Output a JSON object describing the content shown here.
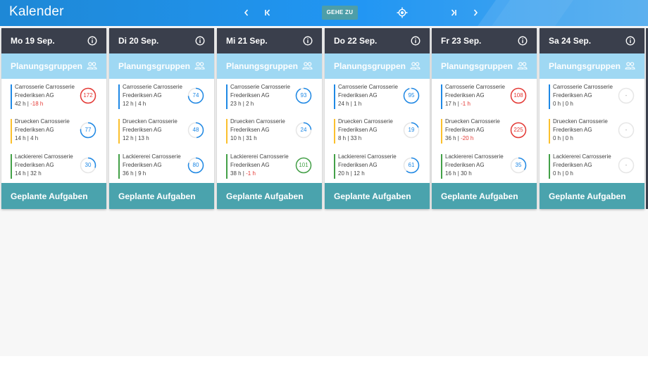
{
  "header": {
    "title": "Kalender",
    "prev_icon": "chevron-left-icon",
    "first_icon": "skip-first-icon",
    "goto_label": "GEHE ZU",
    "locate_icon": "crosshair-icon",
    "last_icon": "skip-last-icon",
    "next_icon": "chevron-right-icon"
  },
  "labels": {
    "planning_groups": "Planungsgruppen",
    "planned_tasks": "Geplante Aufgaben"
  },
  "colors": {
    "topbar": "#2196f3",
    "day_header": "#3a3f4c",
    "planning_bar": "#9fd8f3",
    "tasks_bar": "#4aa3ad",
    "group_blue": "#1e88e5",
    "group_yellow": "#fbc02d",
    "group_green": "#43a047",
    "ring_blue": "#1e88e5",
    "ring_red": "#e53935",
    "ring_green": "#43a047",
    "ring_empty": "#bdbdbd"
  },
  "days": [
    {
      "name": "Mo 19 Sep.",
      "entries": [
        {
          "name_line1": "Carrosserie Carrosserie",
          "name_line2": "Frederiksen AG",
          "h1": "42 h",
          "sep": " | ",
          "h2": "-18 h",
          "h2_negative": true,
          "load": "172",
          "status": "red",
          "fill": 1.0
        },
        {
          "name_line1": "Druecken Carrosserie",
          "name_line2": "Frederiksen AG",
          "h1": "14 h",
          "sep": " | ",
          "h2": "4 h",
          "h2_negative": false,
          "load": "77",
          "status": "blue",
          "fill": 0.77
        },
        {
          "name_line1": "Lackiererei Carrosserie",
          "name_line2": "Frederiksen AG",
          "h1": "14 h",
          "sep": " | ",
          "h2": "32 h",
          "h2_negative": false,
          "load": "30",
          "status": "blue",
          "fill": 0.3
        }
      ]
    },
    {
      "name": "Di 20 Sep.",
      "entries": [
        {
          "name_line1": "Carrosserie Carrosserie",
          "name_line2": "Frederiksen AG",
          "h1": "12 h",
          "sep": " | ",
          "h2": "4 h",
          "h2_negative": false,
          "load": "74",
          "status": "blue",
          "fill": 0.74
        },
        {
          "name_line1": "Druecken Carrosserie",
          "name_line2": "Frederiksen AG",
          "h1": "12 h",
          "sep": " | ",
          "h2": "13 h",
          "h2_negative": false,
          "load": "48",
          "status": "blue",
          "fill": 0.48
        },
        {
          "name_line1": "Lackiererei Carrosserie",
          "name_line2": "Frederiksen AG",
          "h1": "36 h",
          "sep": " | ",
          "h2": "9 h",
          "h2_negative": false,
          "load": "80",
          "status": "blue",
          "fill": 0.8
        }
      ]
    },
    {
      "name": "Mi 21 Sep.",
      "entries": [
        {
          "name_line1": "Carrosserie Carrosserie",
          "name_line2": "Frederiksen AG",
          "h1": "23 h",
          "sep": " | ",
          "h2": "2 h",
          "h2_negative": false,
          "load": "93",
          "status": "blue",
          "fill": 0.93
        },
        {
          "name_line1": "Druecken Carrosserie",
          "name_line2": "Frederiksen AG",
          "h1": "10 h",
          "sep": " | ",
          "h2": "31 h",
          "h2_negative": false,
          "load": "24",
          "status": "blue",
          "fill": 0.24
        },
        {
          "name_line1": "Lackiererei Carrosserie",
          "name_line2": "Frederiksen AG",
          "h1": "38 h",
          "sep": " | ",
          "h2": "-1 h",
          "h2_negative": true,
          "load": "101",
          "status": "green",
          "fill": 1.0
        }
      ]
    },
    {
      "name": "Do 22 Sep.",
      "entries": [
        {
          "name_line1": "Carrosserie Carrosserie",
          "name_line2": "Frederiksen AG",
          "h1": "24 h",
          "sep": " | ",
          "h2": "1 h",
          "h2_negative": false,
          "load": "95",
          "status": "blue",
          "fill": 0.95
        },
        {
          "name_line1": "Druecken Carrosserie",
          "name_line2": "Frederiksen AG",
          "h1": "8 h",
          "sep": " | ",
          "h2": "33 h",
          "h2_negative": false,
          "load": "19",
          "status": "blue",
          "fill": 0.19
        },
        {
          "name_line1": "Lackiererei Carrosserie",
          "name_line2": "Frederiksen AG",
          "h1": "20 h",
          "sep": " | ",
          "h2": "12 h",
          "h2_negative": false,
          "load": "61",
          "status": "blue",
          "fill": 0.61
        }
      ]
    },
    {
      "name": "Fr 23 Sep.",
      "entries": [
        {
          "name_line1": "Carrosserie Carrosserie",
          "name_line2": "Frederiksen AG",
          "h1": "17 h",
          "sep": " | ",
          "h2": "-1 h",
          "h2_negative": true,
          "load": "108",
          "status": "red",
          "fill": 1.0
        },
        {
          "name_line1": "Druecken Carrosserie",
          "name_line2": "Frederiksen AG",
          "h1": "36 h",
          "sep": " | ",
          "h2": "-20 h",
          "h2_negative": true,
          "load": "225",
          "status": "red",
          "fill": 1.0
        },
        {
          "name_line1": "Lackiererei Carrosserie",
          "name_line2": "Frederiksen AG",
          "h1": "16 h",
          "sep": " | ",
          "h2": "30 h",
          "h2_negative": false,
          "load": "35",
          "status": "blue",
          "fill": 0.35
        }
      ]
    },
    {
      "name": "Sa 24 Sep.",
      "entries": [
        {
          "name_line1": "Carrosserie Carrosserie",
          "name_line2": "Frederiksen AG",
          "h1": "0 h",
          "sep": " | ",
          "h2": "0 h",
          "h2_negative": false,
          "load": "-",
          "status": "empty",
          "fill": 0
        },
        {
          "name_line1": "Druecken Carrosserie",
          "name_line2": "Frederiksen AG",
          "h1": "0 h",
          "sep": " | ",
          "h2": "0 h",
          "h2_negative": false,
          "load": "-",
          "status": "empty",
          "fill": 0
        },
        {
          "name_line1": "Lackiererei Carrosserie",
          "name_line2": "Frederiksen AG",
          "h1": "0 h",
          "sep": " | ",
          "h2": "0 h",
          "h2_negative": false,
          "load": "-",
          "status": "empty",
          "fill": 0
        }
      ]
    }
  ]
}
